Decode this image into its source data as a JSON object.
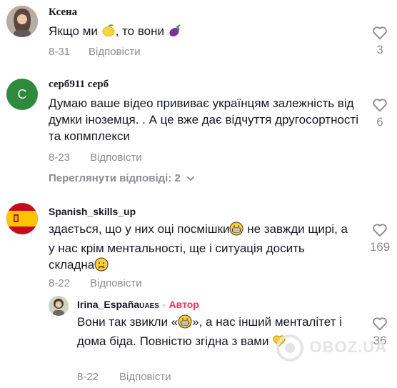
{
  "comments": [
    {
      "username": "Ксена",
      "text_before": "Якщо ми ",
      "text_middle": ", то вони ",
      "icons": [
        "lemon-emoji",
        "eggplant-emoji"
      ],
      "date": "8-31",
      "reply_label": "Відповісти",
      "likes": "3"
    },
    {
      "username": "серб911 серб",
      "avatar_letter": "C",
      "text": "Думаю ваше відео прививає українцям залежність від думки іноземця. . А це вже дає відчуття другосортності та копмплекси",
      "date": "8-23",
      "reply_label": "Відповісти",
      "likes": "6",
      "view_replies": "Переглянути відповіді: 2"
    },
    {
      "username": "Spanish_skills_up",
      "text_a": "здається, що у них оці посмішки",
      "text_b": " не завжди щирі, а у нас крім ментальності, ще і ситуація досить складна",
      "icons": [
        "grinning-emoji",
        "crying-emoji"
      ],
      "date": "8-22",
      "reply_label": "Відповісти",
      "likes": "169"
    },
    {
      "username": "Irina_España",
      "flags": "UAES",
      "author_label": "Автор",
      "text_a": "Вони так звикли «",
      "text_b": "», а нас інший менталітет і дома біда. Повністю згідна з вами ",
      "icons": [
        "grinning-emoji",
        "yellow-heart-emoji"
      ],
      "date": "8-22",
      "reply_label": "Відповісти",
      "likes": "36"
    }
  ],
  "watermark": "OBOZ.UA",
  "colors": {
    "accent": "#fe2c55",
    "muted": "#8a8b91",
    "text": "#161823",
    "avatar_green": "#2f8a3e"
  }
}
